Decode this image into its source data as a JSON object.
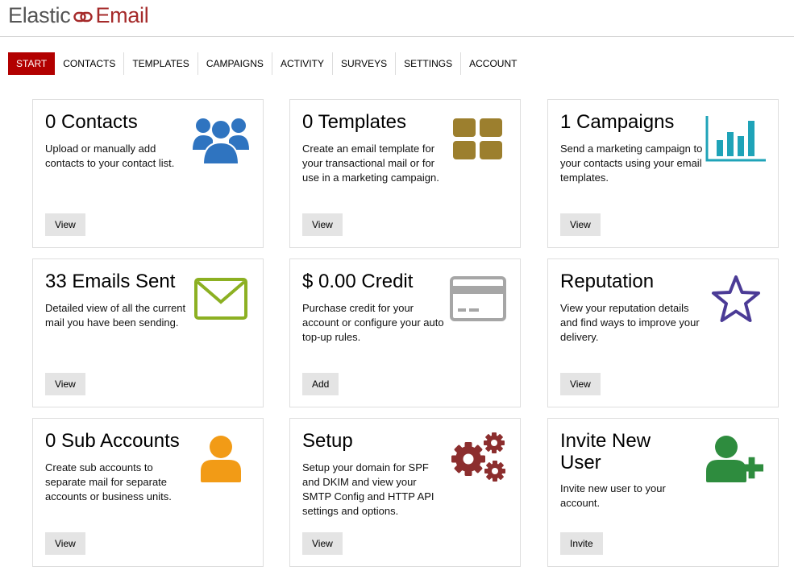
{
  "logo": {
    "word1": "Elastic",
    "word2": "Email"
  },
  "nav": [
    {
      "label": "START",
      "active": true
    },
    {
      "label": "CONTACTS"
    },
    {
      "label": "TEMPLATES"
    },
    {
      "label": "CAMPAIGNS"
    },
    {
      "label": "ACTIVITY"
    },
    {
      "label": "SURVEYS"
    },
    {
      "label": "SETTINGS"
    },
    {
      "label": "ACCOUNT"
    }
  ],
  "cards": [
    {
      "title": "0 Contacts",
      "desc": "Upload or manually add contacts to your contact list.",
      "button": "View",
      "icon": "users-icon",
      "color": "#2f74c0"
    },
    {
      "title": "0 Templates",
      "desc": "Create an email template for your transactional mail or for use in a marketing campaign.",
      "button": "View",
      "icon": "grid-icon",
      "color": "#9c7f2e"
    },
    {
      "title": "1 Campaigns",
      "desc": "Send a marketing campaign to your contacts using your email templates.",
      "button": "View",
      "icon": "bar-chart-icon",
      "color": "#1fa3b8"
    },
    {
      "title": "33 Emails Sent",
      "desc": "Detailed view of all the current mail you have been sending.",
      "button": "View",
      "icon": "envelope-icon",
      "color": "#8cb022"
    },
    {
      "title": "$ 0.00 Credit",
      "desc": "Purchase credit for your account or configure your auto top-up rules.",
      "button": "Add",
      "icon": "credit-card-icon",
      "color": "#a6a6a6"
    },
    {
      "title": "Reputation",
      "desc": "View your reputation details and find ways to improve your delivery.",
      "button": "View",
      "icon": "star-icon",
      "color": "#4b3b96"
    },
    {
      "title": "0 Sub Accounts",
      "desc": "Create sub accounts to separate mail for separate accounts or business units.",
      "button": "View",
      "icon": "user-icon",
      "color": "#f29b16"
    },
    {
      "title": "Setup",
      "desc": "Setup your domain for SPF and DKIM and view your SMTP Config and HTTP API settings and options.",
      "button": "View",
      "icon": "gears-icon",
      "color": "#8c2e2e"
    },
    {
      "title": "Invite New User",
      "desc": "Invite new user to your account.",
      "button": "Invite",
      "icon": "user-plus-icon",
      "color": "#2e8c3e"
    }
  ]
}
